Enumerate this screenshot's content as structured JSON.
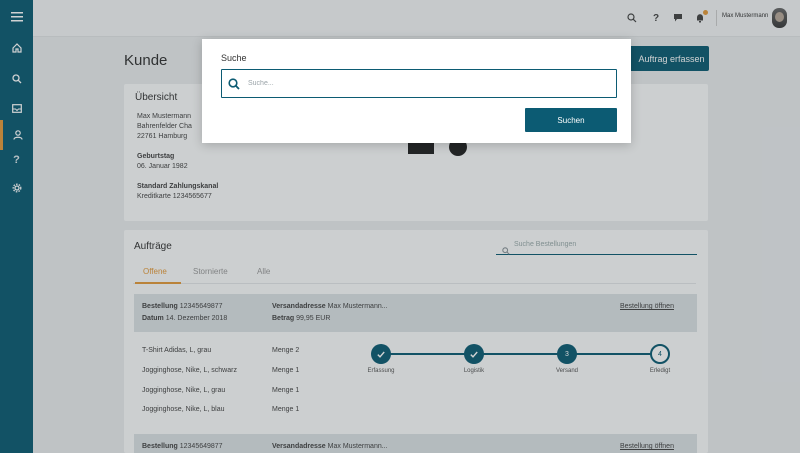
{
  "topbar": {
    "user_name": "Max Mustermann"
  },
  "sidebar": {
    "help_glyph": "?"
  },
  "page": {
    "title": "Kunde",
    "create_order_label": "Auftrag erfassen"
  },
  "overview": {
    "title": "Übersicht",
    "address_line1": "Max Mustermann",
    "address_line2": "Bahrenfelder Cha",
    "address_line3": "22761 Hamburg",
    "birthday_label": "Geburtstag",
    "birthday_value": "06. Januar 1982",
    "payment_label": "Standard Zahlungskanal",
    "payment_value": "Kreditkarte 1234565677"
  },
  "orders": {
    "title": "Aufträge",
    "search_placeholder": "Suche Bestellungen",
    "tabs": [
      "Offene",
      "Stornierte",
      "Alle"
    ],
    "order1": {
      "order_label": "Bestellung",
      "order_no": "12345649877",
      "date_label": "Datum",
      "date_value": "14. Dezember 2018",
      "ship_label": "Versandadresse",
      "ship_value": "Max Mustermann...",
      "amount_label": "Betrag",
      "amount_value": "99,95 EUR",
      "open_link": "Bestellung öffnen",
      "items": [
        {
          "name": "T-Shirt Adidas, L, grau",
          "qty": "Menge 2"
        },
        {
          "name": "Jogginghose, Nike, L, schwarz",
          "qty": "Menge 1"
        },
        {
          "name": "Jogginghose, Nike, L, grau",
          "qty": "Menge 1"
        },
        {
          "name": "Jogginghose, Nike, L, blau",
          "qty": "Menge 1"
        }
      ],
      "steps": [
        {
          "label": "Erfassung",
          "state": "done",
          "num": "1"
        },
        {
          "label": "Logistik",
          "state": "done",
          "num": "2"
        },
        {
          "label": "Versand",
          "state": "current",
          "num": "3"
        },
        {
          "label": "Erledigt",
          "state": "open",
          "num": "4"
        }
      ]
    },
    "order2": {
      "order_label": "Bestellung",
      "order_no": "12345649877",
      "ship_label": "Versandadresse",
      "ship_value": "Max Mustermann...",
      "open_link": "Bestellung öffnen"
    }
  },
  "modal": {
    "title": "Suche",
    "placeholder": "Suche...",
    "value": "",
    "button_label": "Suchen"
  },
  "colors": {
    "brand": "#0c5b73",
    "accent": "#e39a3b"
  }
}
